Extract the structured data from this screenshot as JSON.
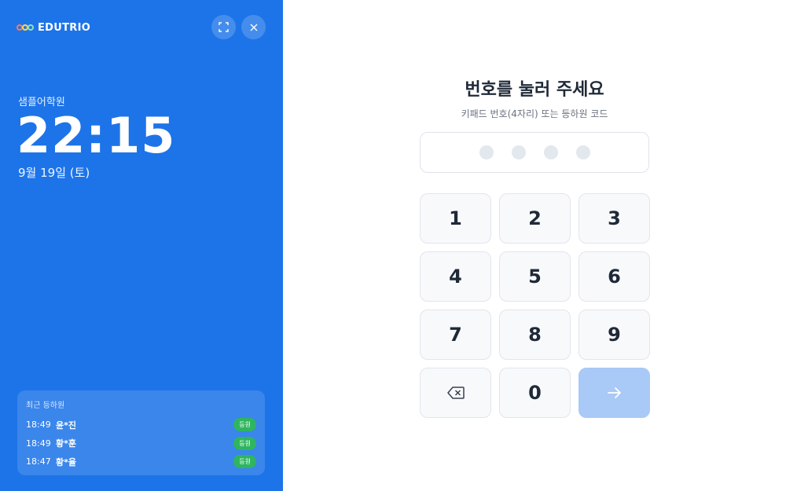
{
  "brand": {
    "name": "EDUTRIO"
  },
  "header": {
    "fullscreen_icon": "fullscreen-icon",
    "close_icon": "close-icon"
  },
  "academy": "샘플어학원",
  "clock": {
    "time": "22:15",
    "date": "9월 19일 (토)"
  },
  "recent": {
    "title": "최근 등하원",
    "rows": [
      {
        "time": "18:49",
        "name": "윤*진",
        "status": "등원"
      },
      {
        "time": "18:49",
        "name": "황*훈",
        "status": "등원"
      },
      {
        "time": "18:47",
        "name": "황*율",
        "status": "등원"
      }
    ]
  },
  "main": {
    "title": "번호를 눌러 주세요",
    "subtitle": "키패드 번호(4자리) 또는 등하원 코드"
  },
  "keypad": {
    "keys": [
      "1",
      "2",
      "3",
      "4",
      "5",
      "6",
      "7",
      "8",
      "9",
      "",
      "0",
      ""
    ],
    "backspace_icon": "backspace-icon",
    "enter_icon": "arrow-right-icon"
  },
  "colors": {
    "primary": "#1d74e8",
    "badge": "#2fb55f",
    "enter_disabled": "#a9c9f6"
  }
}
